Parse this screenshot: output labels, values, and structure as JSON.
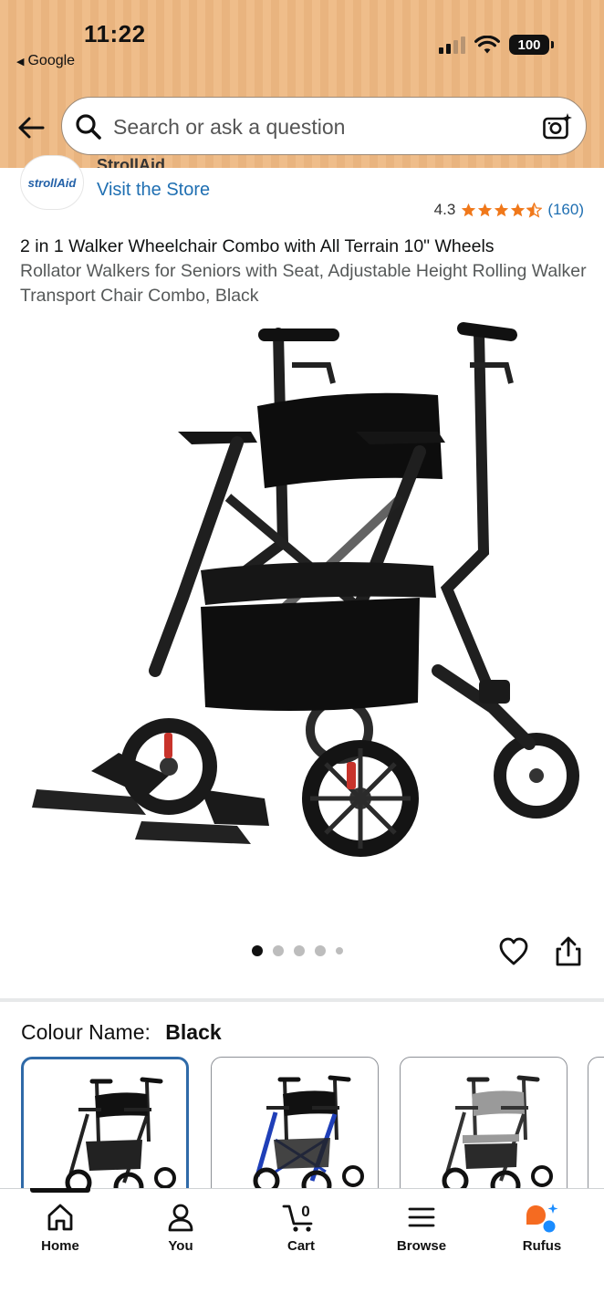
{
  "status_bar": {
    "time": "11:22",
    "back_app_label": "Google",
    "battery": "100"
  },
  "search": {
    "placeholder": "Search or ask a question"
  },
  "brand": {
    "logo_text": "strollAid",
    "name": "StrollAid",
    "visit_store": "Visit the Store"
  },
  "rating": {
    "value": "4.3",
    "stars": 4.3,
    "count": "(160)"
  },
  "product": {
    "title_main": "2 in 1 Walker Wheelchair Combo with All Terrain 10\" Wheels",
    "title_sub": "Rollator Walkers for Seniors with Seat, Adjustable Height Rolling Walker Transport Chair Combo, Black",
    "image_count": 5,
    "active_image": 1
  },
  "colour": {
    "label": "Colour Name:",
    "selected": "Black",
    "swatch_colors": [
      "#1a1a1a",
      "#1f3fb8",
      "#9a9a9a"
    ]
  },
  "bottom_nav": {
    "items": [
      {
        "label": "Home",
        "icon": "home-icon"
      },
      {
        "label": "You",
        "icon": "person-icon"
      },
      {
        "label": "Cart",
        "icon": "cart-icon",
        "badge": "0"
      },
      {
        "label": "Browse",
        "icon": "menu-icon"
      },
      {
        "label": "Rufus",
        "icon": "rufus-icon"
      }
    ]
  },
  "colors": {
    "header_bg": "#efbd8a",
    "link_blue": "#1f6fb2",
    "star_orange": "#f0781a",
    "selected_border": "#2f6aa8",
    "rufus_orange": "#f56b21",
    "rufus_blue": "#1a8cff"
  }
}
